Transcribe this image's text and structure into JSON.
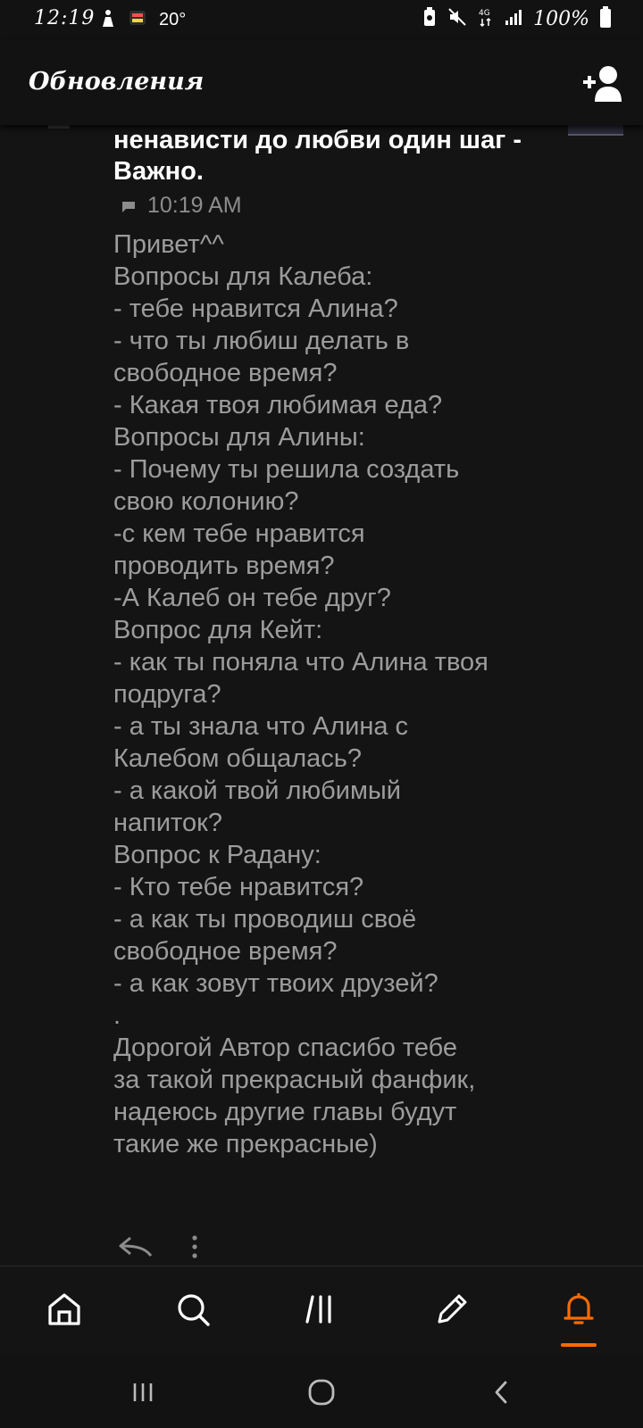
{
  "status_bar": {
    "time": "12:19",
    "temperature": "20°",
    "battery": "100%",
    "network": "4G"
  },
  "header": {
    "title": "Обновления"
  },
  "post": {
    "title_lines": [
      "ненависти до любви один шаг -",
      "Важно."
    ],
    "timestamp": "10:19 AM",
    "body_lines": [
      "Привет^^",
      "Вопросы для Калеба:",
      "- тебе нравится Алина?",
      "- что ты любиш делать в",
      "свободное время?",
      "- Какая твоя любимая еда?",
      "Вопросы для Алины:",
      "- Почему ты решила создать",
      "свою колонию?",
      "-с кем тебе нравится",
      "проводить время?",
      "-А Калеб он тебе друг?",
      "Вопрос для Кейт:",
      "- как ты поняла что Алина твоя",
      "подруга?",
      "- а ты знала что Алина с",
      "Калебом общалась?",
      "- а какой твой любимый",
      "напиток?",
      "Вопрос к Радану:",
      "- Кто тебе нравится?",
      "- а как ты проводиш своё",
      "свободное время?",
      "- а как зовут твоих друзей?",
      ".",
      "Дорогой Автор спасибо тебе",
      "за такой прекрасный фанфик,",
      "надеюсь другие главы будут",
      "такие же прекрасные)"
    ]
  },
  "colors": {
    "accent": "#ff6a00",
    "background": "#141414",
    "body_text": "#9c9c9c"
  },
  "icons": {
    "nav": [
      "home-icon",
      "search-icon",
      "library-icon",
      "pencil-icon",
      "bell-icon"
    ],
    "system": [
      "recent-apps-icon",
      "home-circle-icon",
      "back-chevron-icon"
    ]
  }
}
